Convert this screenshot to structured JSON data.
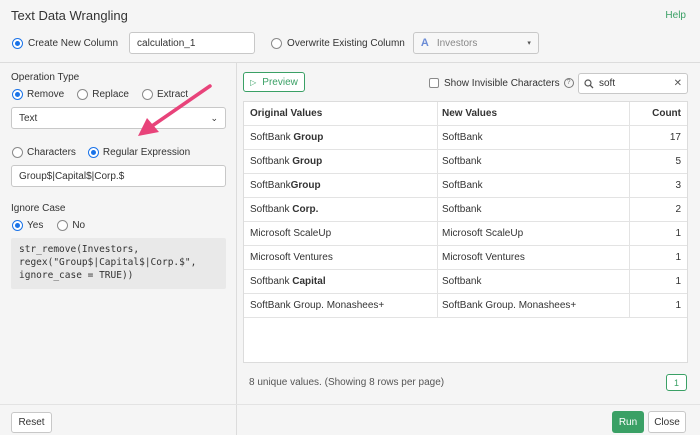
{
  "window": {
    "title": "Text Data Wrangling",
    "help": "Help"
  },
  "column_target": {
    "create_label": "Create New Column",
    "create_value": "calculation_1",
    "overwrite_label": "Overwrite Existing Column",
    "overwrite_type_icon": "A",
    "overwrite_value": "Investors"
  },
  "operation": {
    "label": "Operation Type",
    "options": [
      "Remove",
      "Replace",
      "Extract"
    ],
    "selected": "Remove",
    "target_select": "Text",
    "match_options": [
      "Characters",
      "Regular Expression"
    ],
    "match_selected": "Regular Expression",
    "pattern": "Group$|Capital$|Corp.$",
    "ignore_case_label": "Ignore Case",
    "ignore_case_options": [
      "Yes",
      "No"
    ],
    "ignore_case_selected": "Yes",
    "code_lines": [
      "str_remove(Investors,",
      "regex(\"Group$|Capital$|Corp.$\",",
      "ignore_case = TRUE))"
    ]
  },
  "preview": {
    "button": "Preview",
    "show_invisible_label": "Show Invisible Characters",
    "search_value": "soft"
  },
  "table": {
    "headers": [
      "Original Values",
      "New Values",
      "Count"
    ],
    "rows": [
      {
        "orig_pre": "SoftBank ",
        "orig_bold": "Group",
        "new": "SoftBank",
        "count": "17"
      },
      {
        "orig_pre": "Softbank ",
        "orig_bold": "Group",
        "new": "Softbank",
        "count": "5"
      },
      {
        "orig_pre": "SoftBank",
        "orig_bold": "Group",
        "new": "SoftBank",
        "count": "3"
      },
      {
        "orig_pre": "Softbank ",
        "orig_bold": "Corp.",
        "new": "Softbank",
        "count": "2"
      },
      {
        "orig_pre": "Microsoft ScaleUp",
        "orig_bold": "",
        "new": "Microsoft ScaleUp",
        "count": "1"
      },
      {
        "orig_pre": "Microsoft Ventures",
        "orig_bold": "",
        "new": "Microsoft Ventures",
        "count": "1"
      },
      {
        "orig_pre": "Softbank ",
        "orig_bold": "Capital",
        "new": "Softbank",
        "count": "1"
      },
      {
        "orig_pre": "SoftBank Group. Monashees+",
        "orig_bold": "",
        "new": "SoftBank Group. Monashees+",
        "count": "1"
      }
    ],
    "summary": "8 unique values. (Showing 8 rows per page)",
    "page": "1"
  },
  "footer": {
    "reset": "Reset",
    "run": "Run",
    "close": "Close"
  },
  "colors": {
    "accent_green": "#3aa065",
    "radio_blue": "#1a73e8",
    "arrow_pink": "#e8437a"
  }
}
